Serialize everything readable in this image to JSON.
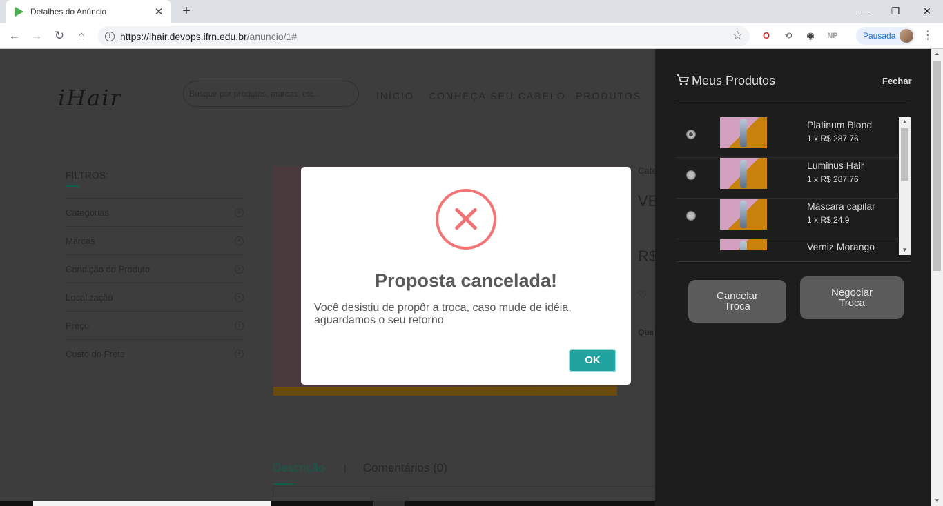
{
  "browser": {
    "tab_title": "Detalhes do Anúncio",
    "url_host": "https://ihair.devops.ifrn.edu.br",
    "url_path": "/anuncio/1#",
    "profile_label": "Pausada",
    "ext_np": "NP"
  },
  "site": {
    "logo": "iHair",
    "search_placeholder": "Busque por produtos, marcas, etc...",
    "nav": [
      "INÍCIO",
      "CONHEÇA SEU CABELO",
      "PRODUTOS"
    ],
    "filters_title": "FILTROS:",
    "filters": [
      "Categorias",
      "Marcas",
      "Condição do Produto",
      "Localização",
      "Preço",
      "Custo do Frete"
    ],
    "right_fragments": [
      "Cate",
      "VE",
      "R$",
      "Qua"
    ],
    "tabs": {
      "description": "Descrição",
      "separator": "|",
      "comments": "Comentários (0)"
    }
  },
  "sidebar": {
    "title": "Meus Produtos",
    "close_label": "Fechar",
    "items": [
      {
        "name": "Platinum Blond",
        "price": "1 x R$ 287.76",
        "checked": true
      },
      {
        "name": "Luminus Hair",
        "price": "1 x R$ 287.76",
        "checked": false
      },
      {
        "name": "Máscara capilar",
        "price": "1 x R$ 24.9",
        "checked": false
      },
      {
        "name": "Verniz Morango",
        "price": "",
        "checked": false
      }
    ],
    "cancel_label": "Cancelar Troca",
    "negotiate_label": "Negociar Troca"
  },
  "modal": {
    "title": "Proposta cancelada!",
    "text": "Você desistiu de propôr a troca, caso mude de idéia, aguardamos o seu retorno",
    "ok_label": "OK",
    "icon": "error-x-icon",
    "icon_color": "#f27474",
    "ok_color": "#20a39e"
  }
}
